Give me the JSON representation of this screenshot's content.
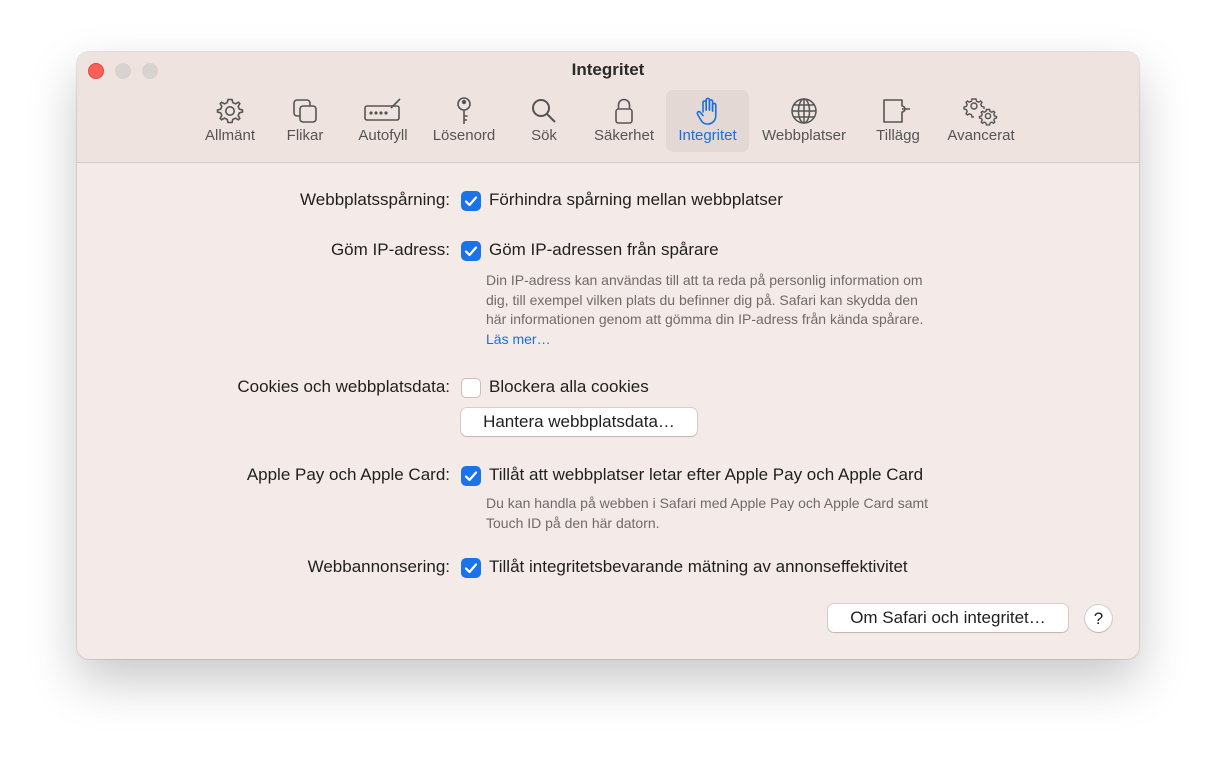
{
  "window": {
    "title": "Integritet"
  },
  "toolbar": {
    "active_color": "#1a6fe0",
    "items": [
      {
        "label": "Allmänt",
        "icon": "gear-icon"
      },
      {
        "label": "Flikar",
        "icon": "tabs-icon"
      },
      {
        "label": "Autofyll",
        "icon": "autofill-icon"
      },
      {
        "label": "Lösenord",
        "icon": "key-icon"
      },
      {
        "label": "Sök",
        "icon": "search-icon"
      },
      {
        "label": "Säkerhet",
        "icon": "lock-icon"
      },
      {
        "label": "Integritet",
        "icon": "hand-icon",
        "active": true
      },
      {
        "label": "Webbplatser",
        "icon": "globe-icon"
      },
      {
        "label": "Tillägg",
        "icon": "puzzle-icon"
      },
      {
        "label": "Avancerat",
        "icon": "gears-icon"
      }
    ]
  },
  "settings": {
    "tracking": {
      "label": "Webbplatsspårning:",
      "option": "Förhindra spårning mellan webbplatser",
      "checked": true
    },
    "hide_ip": {
      "label": "Göm IP-adress:",
      "option": "Göm IP-adressen från spårare",
      "checked": true,
      "description": [
        "Din IP-adress kan användas till att ta reda på personlig information om",
        "dig, till exempel vilken plats du befinner dig på. Safari kan skydda den",
        "här informationen genom att gömma din IP-adress från kända spårare."
      ],
      "link": "Läs mer…"
    },
    "cookies": {
      "label": "Cookies och webbplatsdata:",
      "option": "Blockera alla cookies",
      "checked": false,
      "button": "Hantera webbplatsdata…"
    },
    "apple_pay": {
      "label": "Apple Pay och Apple Card:",
      "option": "Tillåt att webbplatser letar efter Apple Pay och Apple Card",
      "checked": true,
      "description": [
        "Du kan handla på webben i Safari med Apple Pay och Apple Card samt",
        "Touch ID på den här datorn."
      ]
    },
    "ads": {
      "label": "Webbannonsering:",
      "option": "Tillåt integritetsbevarande mätning av annonseffektivitet",
      "checked": true
    }
  },
  "footer": {
    "about_button": "Om Safari och integritet…",
    "help_button": "?"
  }
}
